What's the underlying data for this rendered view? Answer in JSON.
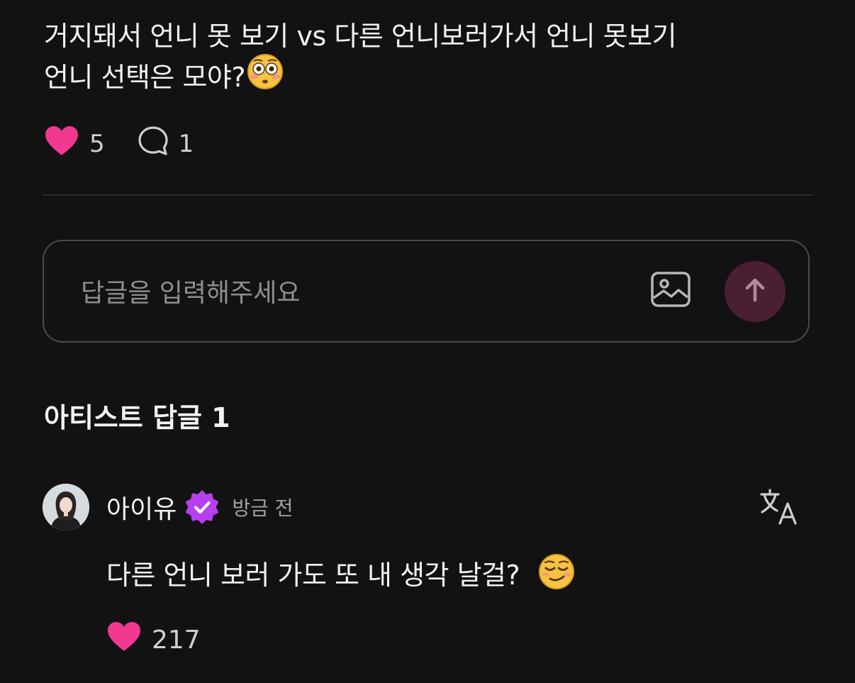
{
  "post": {
    "text_line1": "거지돼서 언니 못 보기 vs 다른 언니보러가서 언니 못보기",
    "text_line2": "언니 선택은 모야?",
    "text_line2_emoji": "flushed-face",
    "like_count": "5",
    "comment_count": "1"
  },
  "reply_box": {
    "placeholder": "답글을 입력해주세요",
    "value": ""
  },
  "artist_replies": {
    "section_title": "아티스트 답글 1"
  },
  "comment": {
    "author": "아이유",
    "verified": true,
    "timestamp": "방금 전",
    "text": "다른 언니 보러 가도 또 내 생각 날걸?",
    "text_emoji": "relieved-smirk-face",
    "like_count": "217"
  },
  "colors": {
    "background": "#121212",
    "heart": "#f0398f",
    "verified_badge": "#b63ff0",
    "send_button": "#4a1f33",
    "divider": "#2c2c2c"
  },
  "icons": {
    "like": "heart-icon",
    "comment": "comment-bubble-icon",
    "image": "image-icon",
    "send": "arrow-up-icon",
    "translate": "translate-icon",
    "verified": "verified-badge-icon"
  }
}
